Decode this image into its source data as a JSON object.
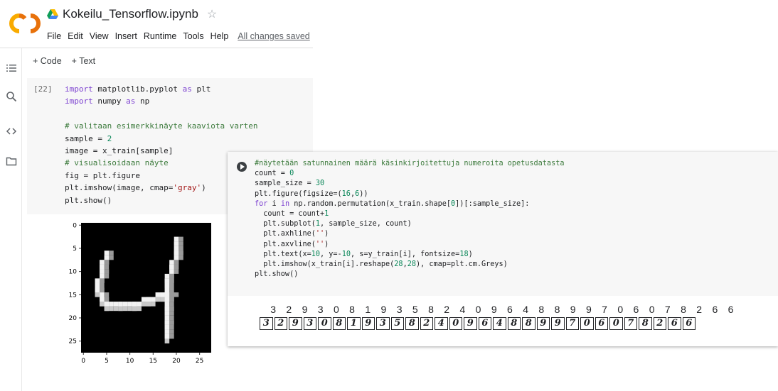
{
  "app": {
    "title": "Kokeilu_Tensorflow.ipynb",
    "star": "☆",
    "menu": [
      "File",
      "Edit",
      "View",
      "Insert",
      "Runtime",
      "Tools",
      "Help"
    ],
    "save_status": "All changes saved"
  },
  "sidebar": {
    "icons": [
      "table-of-contents-icon",
      "search-icon",
      "code-snippets-icon",
      "folder-icon"
    ]
  },
  "toolbar": {
    "code": "+ Code",
    "text": "+ Text"
  },
  "cells": [
    {
      "execution_count": "[22]",
      "code": [
        [
          [
            "kw",
            "import"
          ],
          [
            "p",
            " matplotlib.pyplot "
          ],
          [
            "kw",
            "as"
          ],
          [
            "p",
            " plt"
          ]
        ],
        [
          [
            "kw",
            "import"
          ],
          [
            "p",
            " numpy "
          ],
          [
            "kw",
            "as"
          ],
          [
            "p",
            " np"
          ]
        ],
        [
          [
            "p",
            ""
          ]
        ],
        [
          [
            "cm",
            "# valitaan esimerkkinäyte kaaviota varten"
          ]
        ],
        [
          [
            "p",
            "sample = "
          ],
          [
            "nm",
            "2"
          ]
        ],
        [
          [
            "p",
            "image = x_train[sample]"
          ]
        ],
        [
          [
            "cm",
            "# visualisoidaan näyte"
          ]
        ],
        [
          [
            "p",
            "fig = plt.figure"
          ]
        ],
        [
          [
            "p",
            "plt.imshow(image, cmap="
          ],
          [
            "st",
            "'gray'"
          ],
          [
            "p",
            ")"
          ]
        ],
        [
          [
            "p",
            "plt.show()"
          ]
        ]
      ],
      "output_image": {
        "description_icon": "mnist-digit-four-image",
        "x_ticks": [
          "0",
          "5",
          "10",
          "15",
          "20",
          "25"
        ],
        "y_ticks": [
          "0",
          "5",
          "10",
          "15",
          "20",
          "25"
        ]
      }
    },
    {
      "code": [
        [
          [
            "cm",
            "#näytetään satunnainen määrä käsinkirjoitettuja numeroita opetusdatasta"
          ]
        ],
        [
          [
            "p",
            "count = "
          ],
          [
            "nm",
            "0"
          ]
        ],
        [
          [
            "p",
            "sample_size = "
          ],
          [
            "nm",
            "30"
          ]
        ],
        [
          [
            "p",
            "plt.figure(figsize=("
          ],
          [
            "nm",
            "16"
          ],
          [
            "p",
            ","
          ],
          [
            "nm",
            "6"
          ],
          [
            "p",
            "))"
          ]
        ],
        [
          [
            "kw",
            "for"
          ],
          [
            "p",
            " i "
          ],
          [
            "kw",
            "in"
          ],
          [
            "p",
            " np.random.permutation(x_train.shape["
          ],
          [
            "nm",
            "0"
          ],
          [
            "p",
            "])[:sample_size]:"
          ]
        ],
        [
          [
            "p",
            "  count = count+"
          ],
          [
            "nm",
            "1"
          ]
        ],
        [
          [
            "p",
            "  plt.subplot("
          ],
          [
            "nm",
            "1"
          ],
          [
            "p",
            ", sample_size, count)"
          ]
        ],
        [
          [
            "p",
            "  plt.axhline("
          ],
          [
            "st",
            "''"
          ],
          [
            "p",
            ")"
          ]
        ],
        [
          [
            "p",
            "  plt.axvline("
          ],
          [
            "st",
            "''"
          ],
          [
            "p",
            ")"
          ]
        ],
        [
          [
            "p",
            "  plt.text(x="
          ],
          [
            "nm",
            "10"
          ],
          [
            "p",
            ", y=-"
          ],
          [
            "nm",
            "10"
          ],
          [
            "p",
            ", s=y_train[i], fontsize="
          ],
          [
            "nm",
            "18"
          ],
          [
            "p",
            ")"
          ]
        ],
        [
          [
            "p",
            "  plt.imshow(x_train[i].reshape("
          ],
          [
            "nm",
            "28"
          ],
          [
            "p",
            ","
          ],
          [
            "nm",
            "28"
          ],
          [
            "p",
            "), cmap=plt.cm.Greys)"
          ]
        ],
        [
          [
            "p",
            "plt.show()"
          ]
        ]
      ],
      "output_labels": [
        "3",
        "2",
        "9",
        "3",
        "0",
        "8",
        "1",
        "9",
        "3",
        "5",
        "8",
        "2",
        "4",
        "0",
        "9",
        "6",
        "4",
        "8",
        "8",
        "9",
        "9",
        "7",
        "0",
        "6",
        "0",
        "7",
        "8",
        "2",
        "6",
        "6"
      ]
    }
  ],
  "colors": {
    "background": "#ffffff",
    "cell_bg": "#f7f7f7",
    "keyword": "#7b3fd0",
    "comment": "#3d7b3d",
    "string": "#a31515",
    "number": "#098658"
  }
}
